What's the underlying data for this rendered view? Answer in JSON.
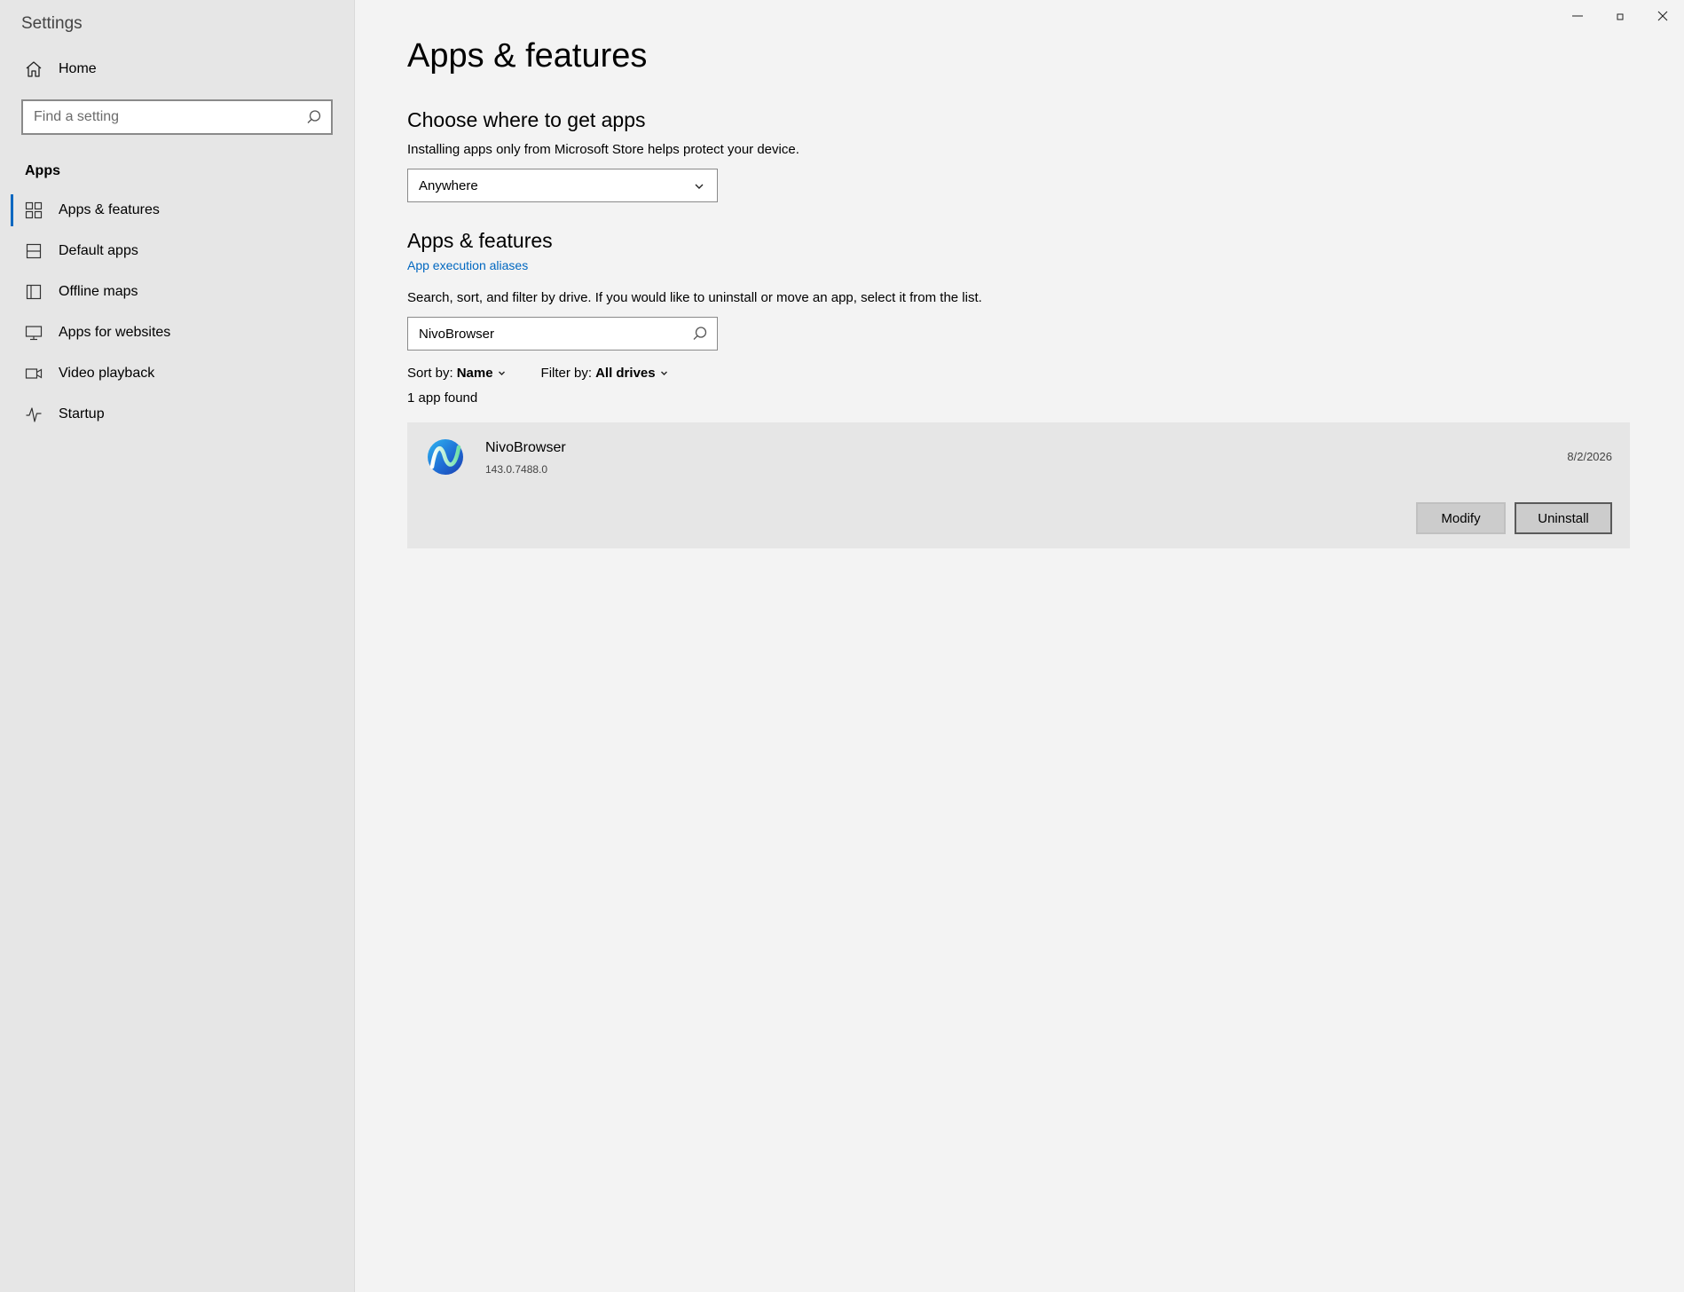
{
  "window": {
    "title": "Settings"
  },
  "sidebar": {
    "home_label": "Home",
    "search_placeholder": "Find a setting",
    "section_label": "Apps",
    "items": [
      {
        "label": "Apps & features",
        "icon": "apps-grid-icon",
        "active": true
      },
      {
        "label": "Default apps",
        "icon": "default-apps-icon",
        "active": false
      },
      {
        "label": "Offline maps",
        "icon": "offline-maps-icon",
        "active": false
      },
      {
        "label": "Apps for websites",
        "icon": "monitor-icon",
        "active": false
      },
      {
        "label": "Video playback",
        "icon": "video-camera-icon",
        "active": false
      },
      {
        "label": "Startup",
        "icon": "startup-pulse-icon",
        "active": false
      }
    ]
  },
  "main": {
    "title": "Apps & features",
    "choose_heading": "Choose where to get apps",
    "choose_desc": "Installing apps only from Microsoft Store helps protect your device.",
    "source_dropdown_value": "Anywhere",
    "apps_heading": "Apps & features",
    "aliases_link": "App execution aliases",
    "search_desc": "Search, sort, and filter by drive. If you would like to uninstall or move an app, select it from the list.",
    "app_search_value": "NivoBrowser",
    "sort_label": "Sort by:",
    "sort_value": "Name",
    "filter_label": "Filter by:",
    "filter_value": "All drives",
    "result_count": "1 app found",
    "app": {
      "name": "NivoBrowser",
      "version": "143.0.7488.0",
      "date": "8/2/2026",
      "modify_label": "Modify",
      "uninstall_label": "Uninstall"
    }
  },
  "colors": {
    "accent": "#0067c0",
    "sidebar_bg": "#e6e6e6",
    "main_bg": "#f3f3f3",
    "card_bg": "#e6e6e6"
  }
}
